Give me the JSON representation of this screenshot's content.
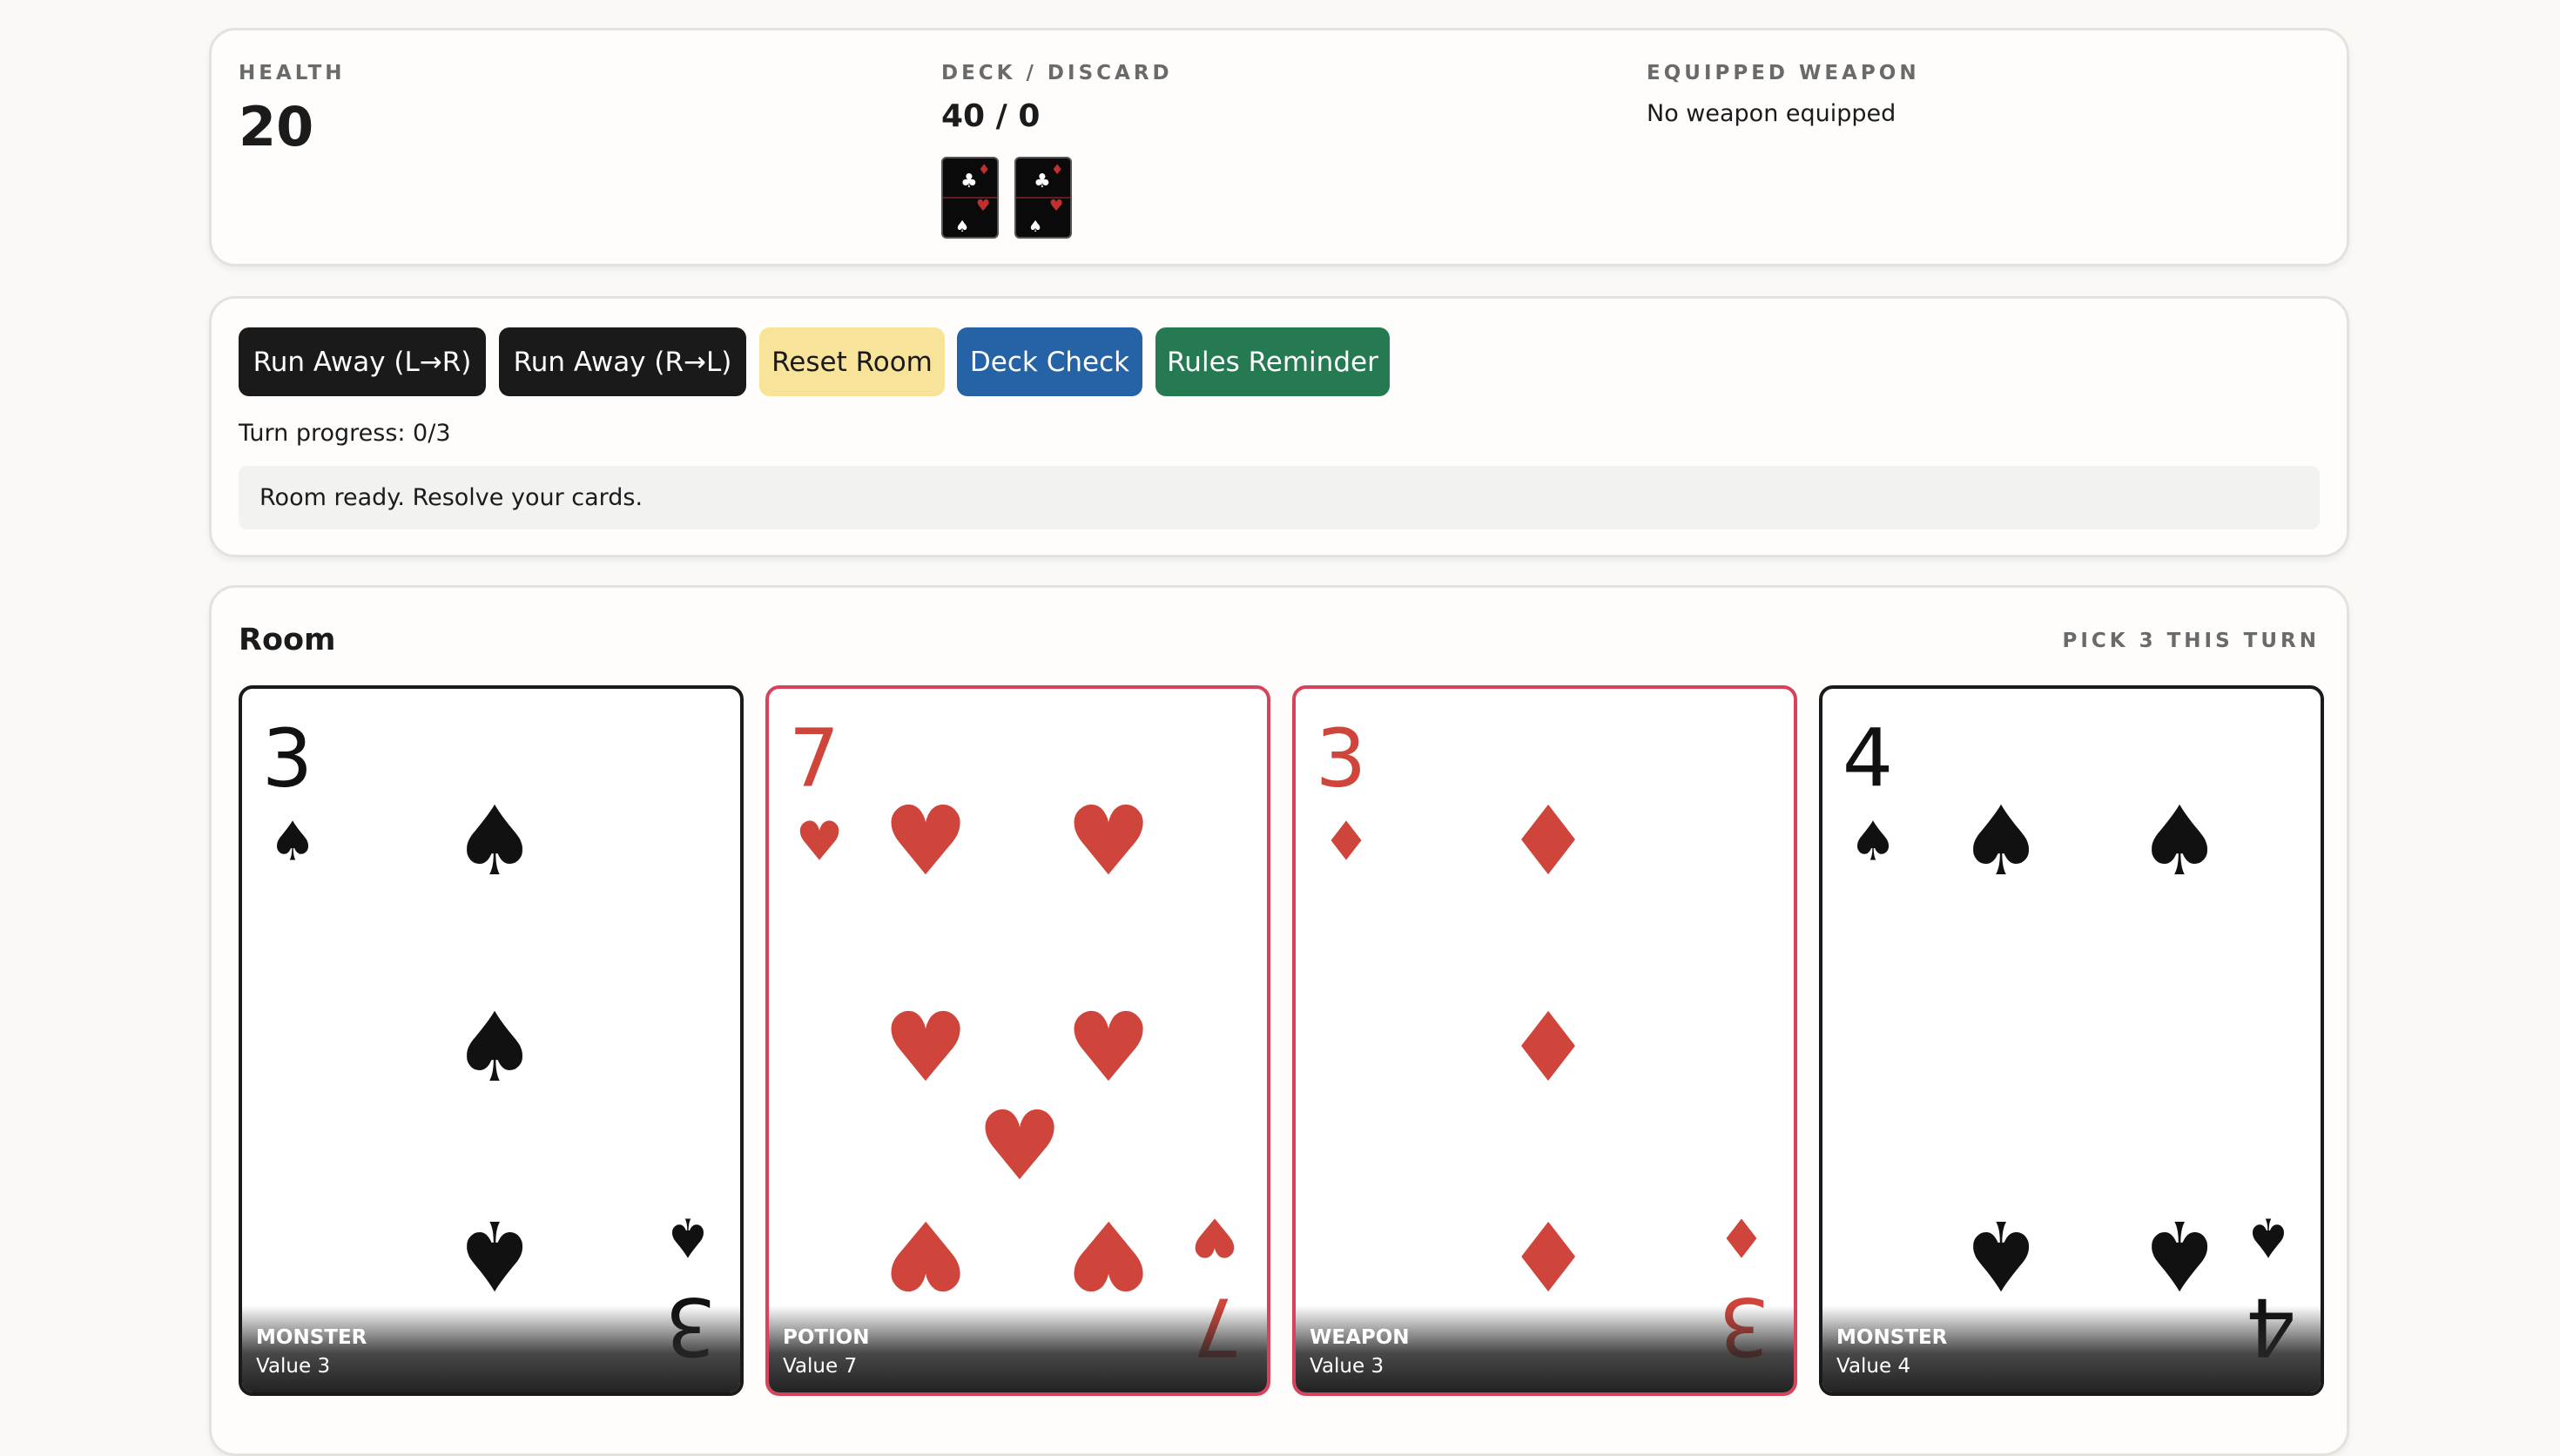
{
  "stats": {
    "health_label": "HEALTH",
    "health_value": "20",
    "deck_label": "DECK / DISCARD",
    "deck_value": "40 / 0",
    "weapon_label": "EQUIPPED WEAPON",
    "weapon_value": "No weapon equipped"
  },
  "actions": {
    "run_away_lr": "Run Away (L→R)",
    "run_away_rl": "Run Away (R→L)",
    "reset_room": "Reset Room",
    "deck_check": "Deck Check",
    "rules_reminder": "Rules Reminder",
    "turn_progress": "Turn progress: 0/3",
    "message": "Room ready. Resolve your cards."
  },
  "room": {
    "title": "Room",
    "pick_hint": "PICK 3 THIS TURN",
    "cards": [
      {
        "rank": "3",
        "suit": "spade",
        "type": "MONSTER",
        "value_text": "Value 3",
        "color": "#111111"
      },
      {
        "rank": "7",
        "suit": "heart",
        "type": "POTION",
        "value_text": "Value 7",
        "color": "#d0453b"
      },
      {
        "rank": "3",
        "suit": "diamond",
        "type": "WEAPON",
        "value_text": "Value 3",
        "color": "#d0453b"
      },
      {
        "rank": "4",
        "suit": "spade",
        "type": "MONSTER",
        "value_text": "Value 4",
        "color": "#111111"
      }
    ]
  },
  "icons": [
    "spade-icon",
    "heart-icon",
    "diamond-icon",
    "club-icon"
  ]
}
